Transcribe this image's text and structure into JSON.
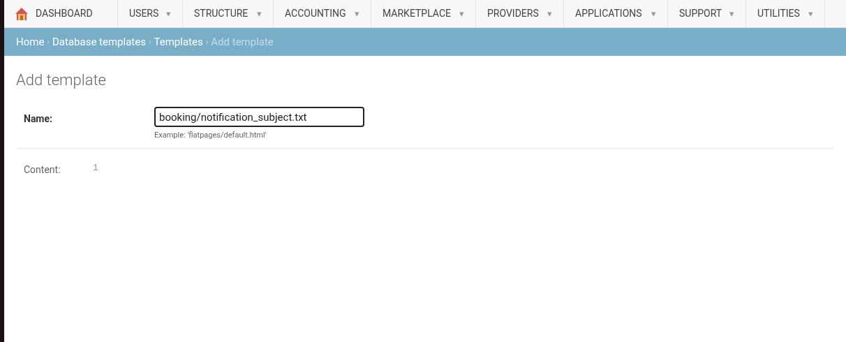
{
  "nav": {
    "home": {
      "label": "DASHBOARD"
    },
    "menus": [
      {
        "label": "USERS",
        "caret": "▾"
      },
      {
        "label": "STRUCTURE",
        "caret": "▾"
      },
      {
        "label": "ACCOUNTING",
        "caret": "▾"
      },
      {
        "label": "MARKETPLACE",
        "caret": "▾"
      },
      {
        "label": "PROVIDERS",
        "caret": "▾"
      },
      {
        "label": "APPLICATIONS",
        "caret": "▾"
      },
      {
        "label": "SUPPORT",
        "caret": "▾"
      },
      {
        "label": "UTILITIES",
        "caret": "▾"
      }
    ]
  },
  "breadcrumbs": {
    "separator": "›",
    "items": [
      {
        "label": "Home",
        "current": false
      },
      {
        "label": "Database templates",
        "current": false
      },
      {
        "label": "Templates",
        "current": false
      },
      {
        "label": "Add template",
        "current": true
      }
    ]
  },
  "page_title": "Add template",
  "form": {
    "name": {
      "label": "Name:",
      "value": "booking/notification_subject.txt",
      "help": "Example: 'flatpages/default.html'"
    },
    "content": {
      "label": "Content:",
      "line_numbers": [
        "1"
      ]
    }
  }
}
